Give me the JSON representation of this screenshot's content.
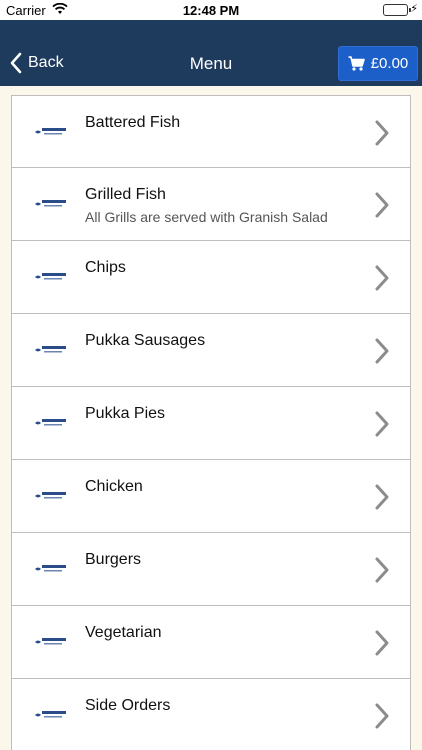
{
  "status_bar": {
    "carrier": "Carrier",
    "time": "12:48 PM"
  },
  "nav": {
    "back_label": "Back",
    "title": "Menu",
    "cart_total": "£0.00"
  },
  "menu": {
    "items": [
      {
        "label": "Battered Fish",
        "subtitle": ""
      },
      {
        "label": "Grilled Fish",
        "subtitle": "All Grills are served with Granish Salad"
      },
      {
        "label": "Chips",
        "subtitle": ""
      },
      {
        "label": "Pukka Sausages",
        "subtitle": ""
      },
      {
        "label": "Pukka Pies",
        "subtitle": ""
      },
      {
        "label": "Chicken",
        "subtitle": ""
      },
      {
        "label": "Burgers",
        "subtitle": ""
      },
      {
        "label": "Vegetarian",
        "subtitle": ""
      },
      {
        "label": "Side Orders",
        "subtitle": ""
      }
    ]
  },
  "colors": {
    "nav_bg": "#1e3a5c",
    "cart_bg": "#1d5fc8",
    "page_bg": "#fbf7ea",
    "arrow": "#8c8c8c"
  },
  "icons": {
    "back": "chevron-left-icon",
    "cart": "shopping-cart-icon",
    "row_arrow": "chevron-right-icon",
    "row_logo": "restaurant-logo"
  }
}
